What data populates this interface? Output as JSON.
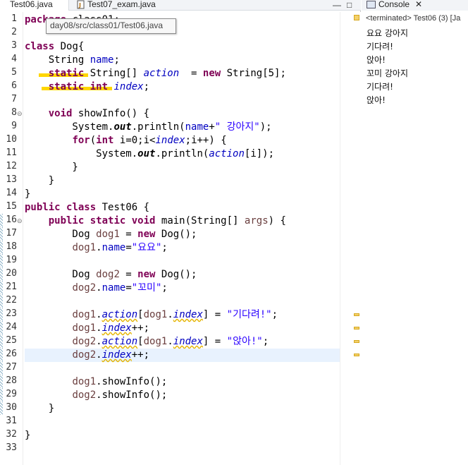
{
  "tabs": {
    "active": "Test06.java",
    "other": "Test07_exam.java"
  },
  "tooltip": "day08/src/class01/Test06.java",
  "console": {
    "tab_label": "Console",
    "status": "<terminated> Test06 (3) [Ja",
    "output": [
      "요요 강아지",
      "기다려!",
      "앉아!",
      "꼬미 강아지",
      "기다려!",
      "앉아!"
    ]
  },
  "editor": {
    "current_line": 26,
    "lines": [
      {
        "n": 1,
        "html": "<span class=\"kw\">package</span> class01;"
      },
      {
        "n": 2,
        "html": ""
      },
      {
        "n": 3,
        "html": "<span class=\"kw\">class</span> Dog{"
      },
      {
        "n": 4,
        "html": "    String <span class=\"fld\">name</span>;"
      },
      {
        "n": 5,
        "html": "    <span class=\"kw\">static</span> String[] <span class=\"sfld\">action</span>  = <span class=\"kw\">new</span> String[5];"
      },
      {
        "n": 6,
        "html": "    <span class=\"kw\">static</span> <span class=\"kw\">int</span> <span class=\"sfld\">index</span>;"
      },
      {
        "n": 7,
        "html": ""
      },
      {
        "n": 8,
        "html": "    <span class=\"kw\">void</span> showInfo() {"
      },
      {
        "n": 9,
        "html": "        System.<span class=\"sfldb\">out</span>.println(<span class=\"fld\">name</span>+<span class=\"str\">\" 강아지\"</span>);"
      },
      {
        "n": 10,
        "html": "        <span class=\"kw\">for</span>(<span class=\"kw\">int</span> i=0;i&lt;<span class=\"sfld\">index</span>;i++) {"
      },
      {
        "n": 11,
        "html": "            System.<span class=\"sfldb\">out</span>.println(<span class=\"sfld\">action</span>[i]);"
      },
      {
        "n": 12,
        "html": "        }"
      },
      {
        "n": 13,
        "html": "    }"
      },
      {
        "n": 14,
        "html": "}"
      },
      {
        "n": 15,
        "html": "<span class=\"kw\">public</span> <span class=\"kw\">class</span> Test06 {"
      },
      {
        "n": 16,
        "html": "    <span class=\"kw\">public</span> <span class=\"kw\">static</span> <span class=\"kw\">void</span> main(String[] <span class=\"par\">args</span>) {"
      },
      {
        "n": 17,
        "html": "        Dog <span class=\"par\">dog1</span> = <span class=\"kw\">new</span> Dog();"
      },
      {
        "n": 18,
        "html": "        <span class=\"par\">dog1</span>.<span class=\"fld\">name</span>=<span class=\"str\">\"요요\"</span>;"
      },
      {
        "n": 19,
        "html": ""
      },
      {
        "n": 20,
        "html": "        Dog <span class=\"par\">dog2</span> = <span class=\"kw\">new</span> Dog();"
      },
      {
        "n": 21,
        "html": "        <span class=\"par\">dog2</span>.<span class=\"fld\">name</span>=<span class=\"str\">\"꼬미\"</span>;"
      },
      {
        "n": 22,
        "html": ""
      },
      {
        "n": 23,
        "html": "        <span class=\"par\">dog1</span>.<span class=\"sfld warn\">action</span>[<span class=\"par\">dog1</span>.<span class=\"sfld warn\">index</span>] = <span class=\"str\">\"기다려!\"</span>;"
      },
      {
        "n": 24,
        "html": "        <span class=\"par\">dog1</span>.<span class=\"sfld warn\">index</span>++;"
      },
      {
        "n": 25,
        "html": "        <span class=\"par\">dog2</span>.<span class=\"sfld warn\">action</span>[<span class=\"par\">dog1</span>.<span class=\"sfld warn\">index</span>] = <span class=\"str\">\"앉아!\"</span>;"
      },
      {
        "n": 26,
        "html": "        <span class=\"par\">dog2</span>.<span class=\"sfld warn\">index</span>++;"
      },
      {
        "n": 27,
        "html": ""
      },
      {
        "n": 28,
        "html": "        <span class=\"par\">dog1</span>.showInfo();"
      },
      {
        "n": 29,
        "html": "        <span class=\"par\">dog2</span>.showInfo();"
      },
      {
        "n": 30,
        "html": "    }"
      },
      {
        "n": 31,
        "html": ""
      },
      {
        "n": 32,
        "html": "}"
      },
      {
        "n": 33,
        "html": ""
      }
    ],
    "fold_lines": [
      8,
      16
    ],
    "marked_lines": [
      16,
      17,
      18,
      19,
      20,
      21,
      22,
      23,
      24,
      25,
      26,
      27,
      28,
      29,
      30
    ],
    "warning_lines": [
      23,
      24,
      25,
      26
    ]
  }
}
